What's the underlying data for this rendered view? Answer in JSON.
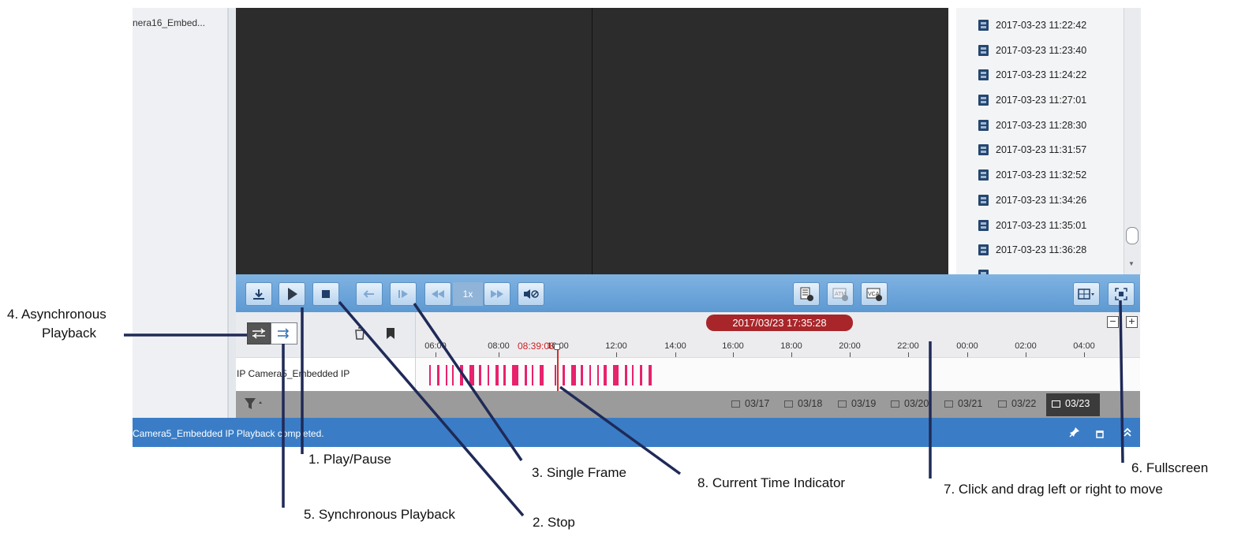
{
  "left_panel": {
    "camera_item": "nera16_Embed..."
  },
  "file_list": [
    "2017-03-23 11:22:42",
    "2017-03-23 11:23:40",
    "2017-03-23 11:24:22",
    "2017-03-23 11:27:01",
    "2017-03-23 11:28:30",
    "2017-03-23 11:31:57",
    "2017-03-23 11:32:52",
    "2017-03-23 11:34:26",
    "2017-03-23 11:35:01",
    "2017-03-23 11:36:28"
  ],
  "toolbar": {
    "speed": "1x",
    "icons": [
      "download-icon",
      "play-icon",
      "stop-icon",
      "reverse-icon",
      "single-frame-icon",
      "slow-down-icon",
      "speed-up-icon",
      "mute-icon",
      "event-list-icon",
      "atm-icon",
      "vca-icon",
      "layout-icon",
      "fullscreen-icon"
    ]
  },
  "timeline": {
    "current_datetime": "2017/03/23 17:35:28",
    "cursor_time": "08:39:08",
    "ticks": [
      "06:00",
      "08:00",
      "10:00",
      "12:00",
      "14:00",
      "16:00",
      "18:00",
      "20:00",
      "22:00",
      "00:00",
      "02:00",
      "04:00"
    ],
    "track_label": "IP Camera5_Embedded IP",
    "zoom_out": "−",
    "zoom_in": "+"
  },
  "dates": [
    "03/17",
    "03/18",
    "03/19",
    "03/20",
    "03/21",
    "03/22",
    "03/23"
  ],
  "active_date": "03/23",
  "status": {
    "message": "Camera5_Embedded IP Playback completed."
  },
  "colors": {
    "toolbar_blue": "#6aa5d9",
    "status_blue": "#3a7dc6",
    "record_pink": "#e8226c",
    "time_pill_red": "#a8262a",
    "annotation_navy": "#1f2a57"
  },
  "annotations": {
    "async": [
      "4. Asynchronous",
      "Playback"
    ],
    "play_pause": "1. Play/Pause",
    "single_frame": "3. Single Frame",
    "current_time": "8. Current Time Indicator",
    "drag": "7. Click and drag left or right to move",
    "fullscreen": "6. Fullscreen",
    "sync": "5. Synchronous Playback",
    "stop": "2. Stop"
  }
}
